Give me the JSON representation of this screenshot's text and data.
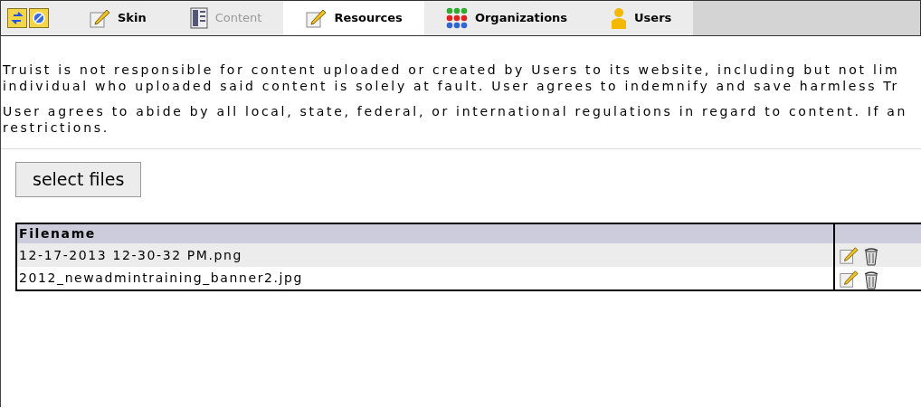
{
  "toolbar_buttons": [
    {
      "kind": "swap"
    },
    {
      "kind": "block"
    }
  ],
  "tabs": [
    {
      "label": "Skin",
      "selected": false,
      "disabled": false
    },
    {
      "label": "Content",
      "selected": false,
      "disabled": true
    },
    {
      "label": "Resources",
      "selected": true,
      "disabled": false
    },
    {
      "label": "Organizations",
      "selected": false,
      "disabled": false
    },
    {
      "label": "Users",
      "selected": false,
      "disabled": false
    }
  ],
  "notice": [
    "Truist is not responsible for content uploaded or created by Users to its website, including but not lim",
    "individual who uploaded said content is solely at fault. User agrees to indemnify and save harmless Tr"
  ],
  "notice2": [
    "User agrees to abide by all local, state, federal, or international regulations in regard to content. If an",
    "restrictions."
  ],
  "select_button": "select files",
  "table": {
    "columns": [
      "Filename"
    ],
    "rows": [
      {
        "filename": "12-17-2013 12-30-32 PM.png"
      },
      {
        "filename": "2012_newadmintraining_banner2.jpg"
      }
    ]
  }
}
